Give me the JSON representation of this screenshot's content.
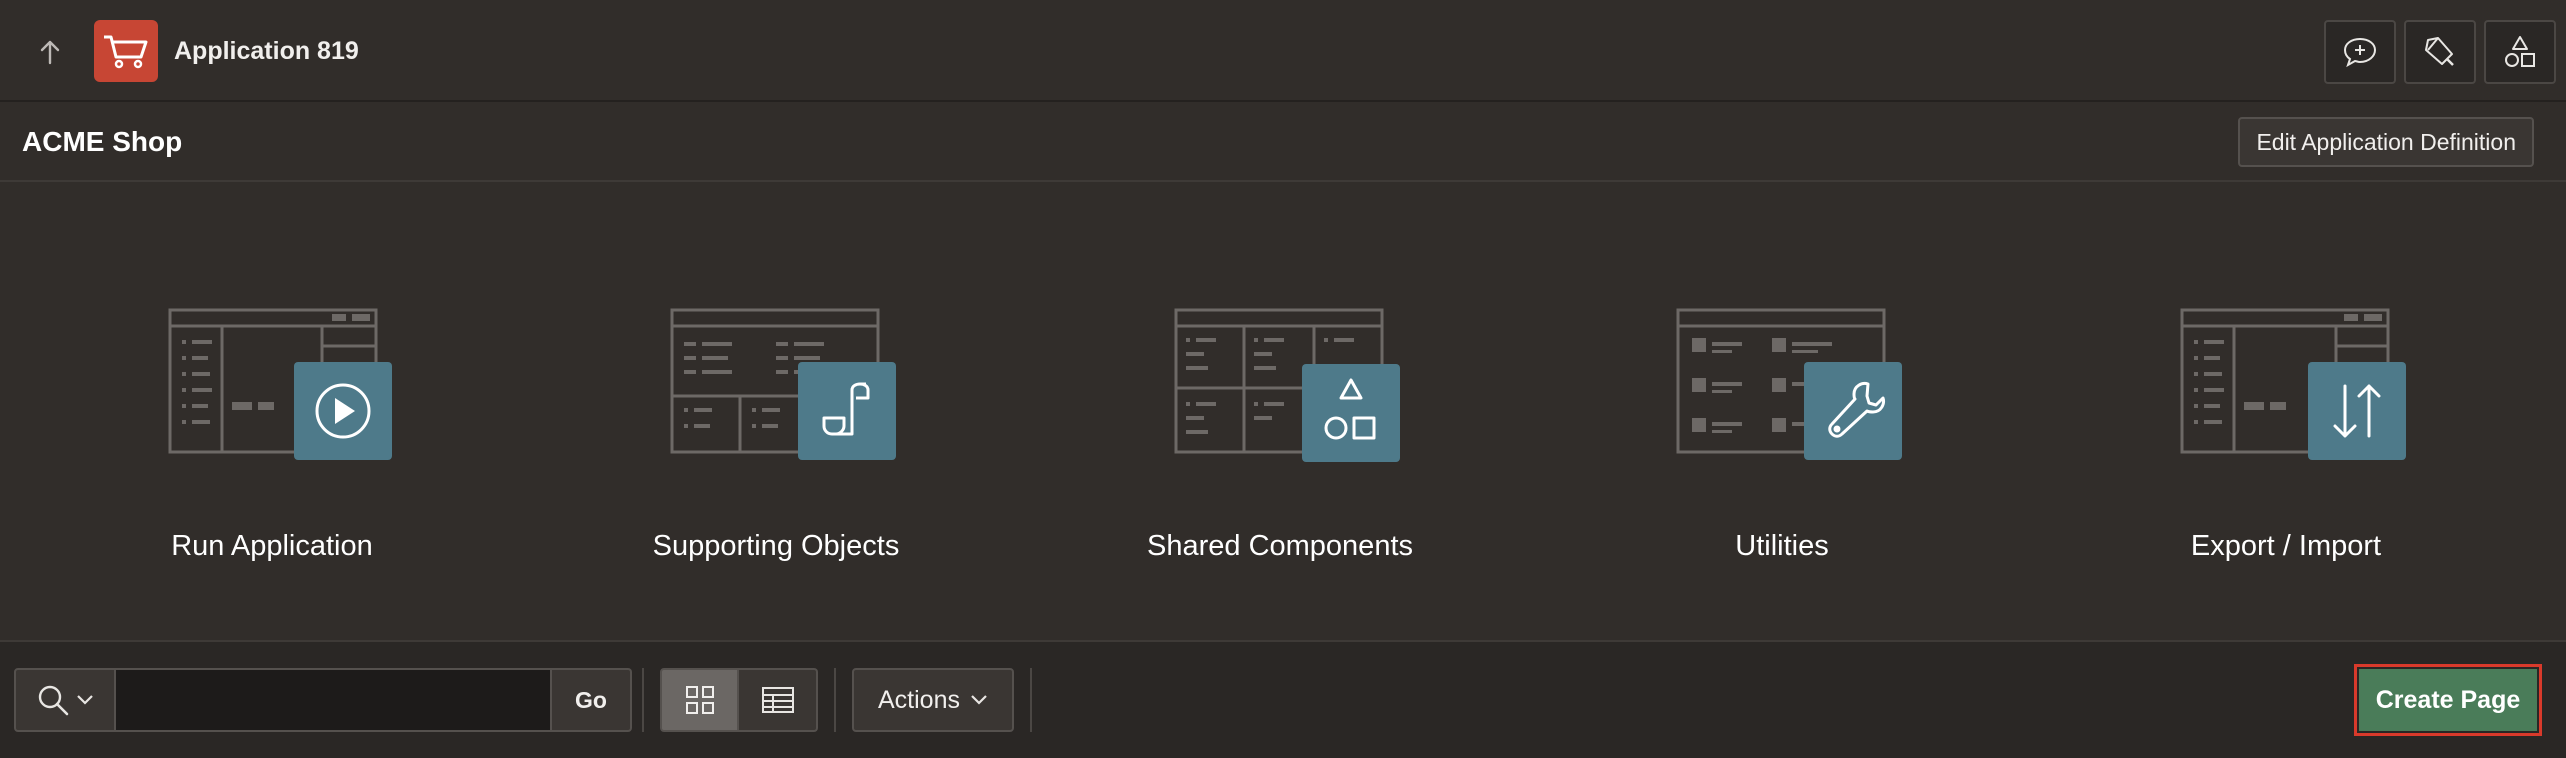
{
  "header": {
    "app_title": "Application 819",
    "buttons": [
      {
        "icon": "comment-plus-icon"
      },
      {
        "icon": "flashlight-icon"
      },
      {
        "icon": "shapes-icon"
      }
    ]
  },
  "app": {
    "name": "ACME Shop",
    "edit_button": "Edit Application Definition"
  },
  "tiles": [
    {
      "label": "Run Application",
      "icon": "play-icon"
    },
    {
      "label": "Supporting Objects",
      "icon": "scroll-icon"
    },
    {
      "label": "Shared Components",
      "icon": "shapes-icon"
    },
    {
      "label": "Utilities",
      "icon": "wrench-icon"
    },
    {
      "label": "Export / Import",
      "icon": "up-down-arrows-icon"
    }
  ],
  "toolbar": {
    "search_value": "",
    "go_label": "Go",
    "actions_label": "Actions",
    "create_page_label": "Create Page"
  },
  "colors": {
    "background": "#312d2a",
    "app_icon": "#c74634",
    "tile_badge": "#4e7a8a",
    "create_button": "#4a7c59",
    "highlight": "#d93a2b"
  }
}
